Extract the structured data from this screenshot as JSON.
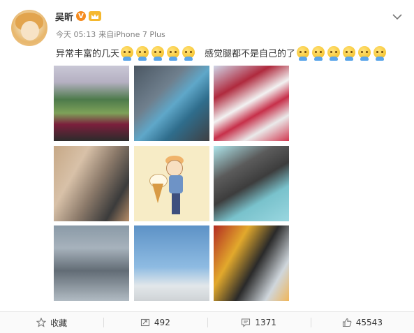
{
  "post": {
    "author": "吴昕",
    "verified_badge": "V",
    "time": "今天 05:13",
    "source": "来自iPhone 7 Plus",
    "text_part1": "异常丰富的几天",
    "text_part2": "感觉腿都不是自己的了",
    "emoji_name": "smiling-face-emoji",
    "emoji_count_part1": 5,
    "emoji_count_part2": 6
  },
  "actions": {
    "favorite_label": "收藏",
    "repost_count": "492",
    "comment_count": "1371",
    "like_count": "45543"
  },
  "colors": {
    "text": "#333333",
    "meta": "#808080",
    "verified": "#f58b1f",
    "action_bar_bg": "#fafafa"
  },
  "icons": {
    "favorite": "star-outline-icon",
    "repost": "repost-icon",
    "comment": "comment-icon",
    "like": "thumbs-up-icon",
    "menu": "chevron-down-icon"
  }
}
